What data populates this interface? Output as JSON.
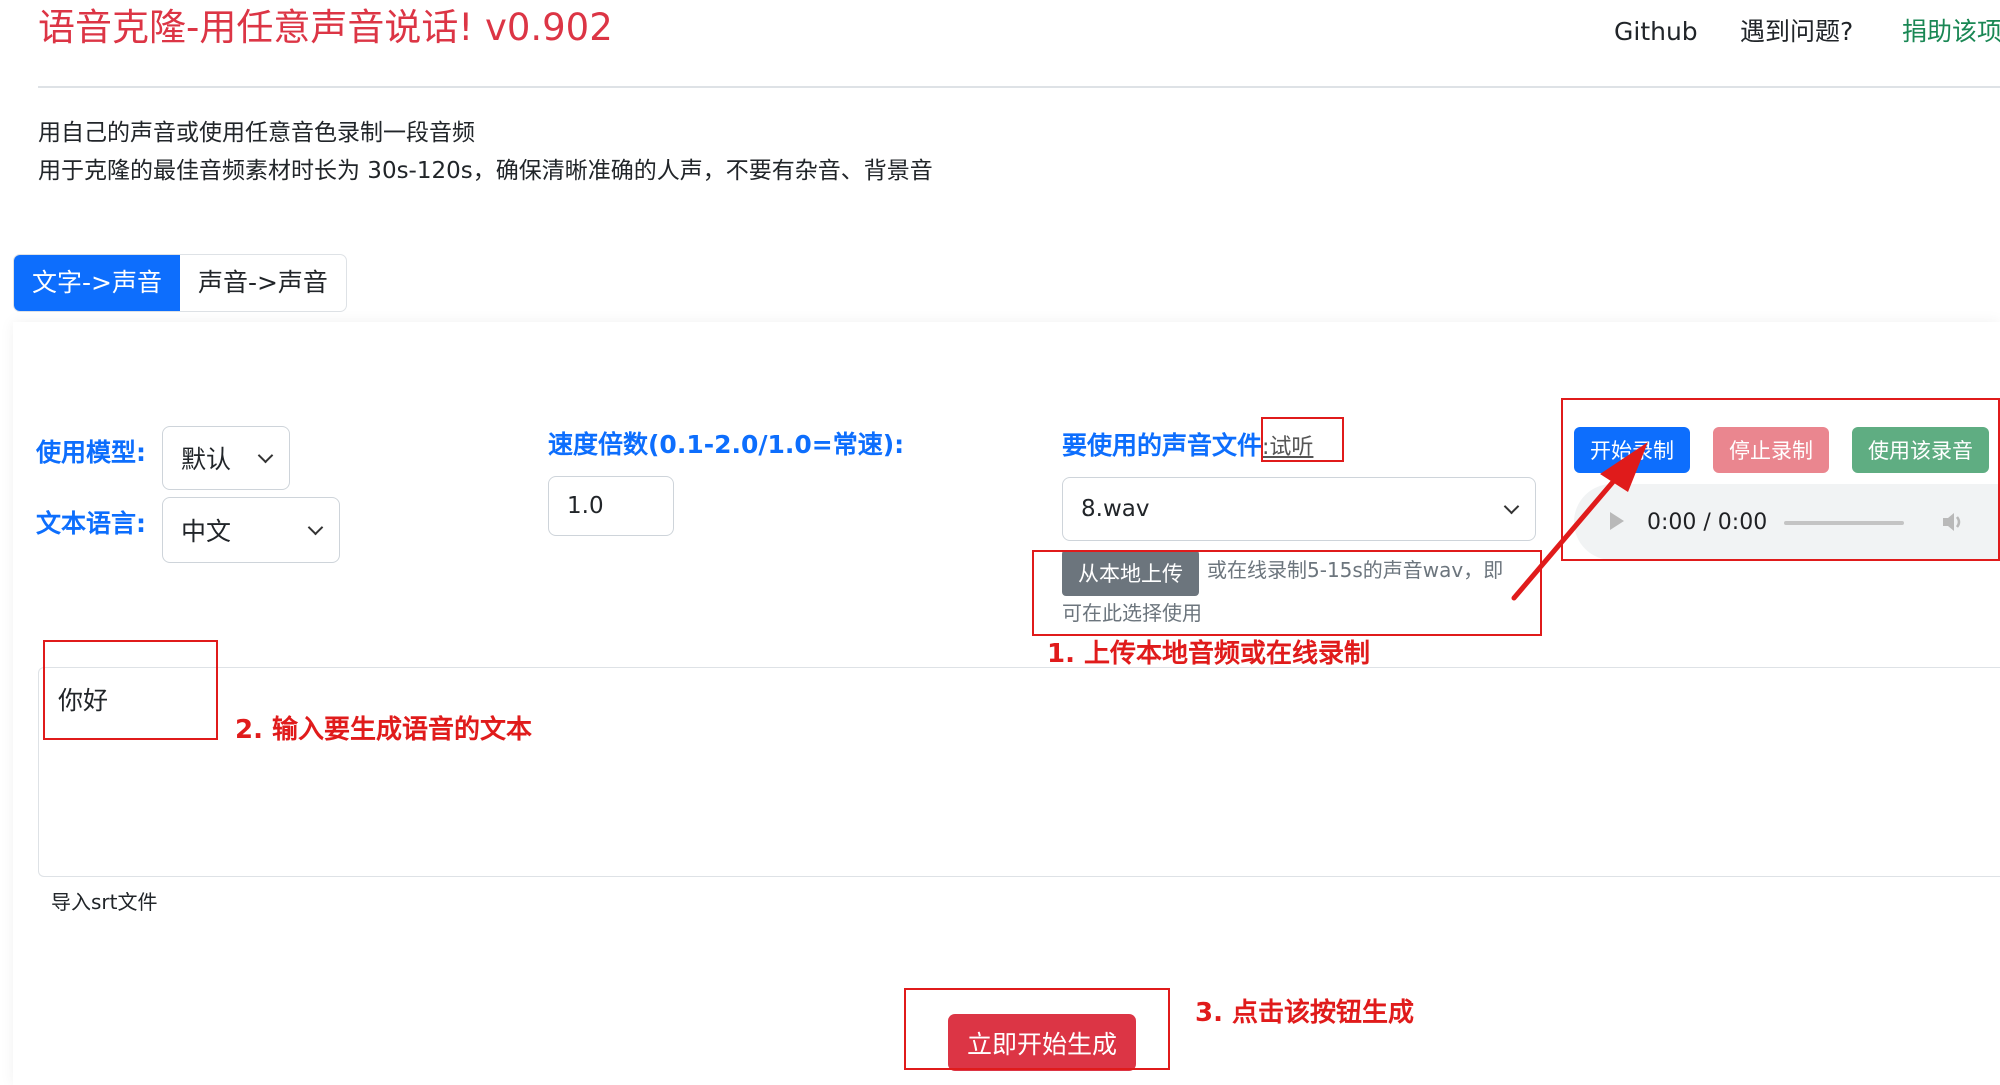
{
  "header": {
    "title": "语音克隆-用任意声音说话! v0.902",
    "nav": [
      "Github",
      "遇到问题?",
      "捐助该项"
    ]
  },
  "intro": {
    "line1": "用自己的声音或使用任意音色录制一段音频",
    "line2": "用于克隆的最佳音频素材时长为 30s-120s，确保清晰准确的人声，不要有杂音、背景音"
  },
  "tabs": [
    {
      "label": "文字->声音",
      "active": true
    },
    {
      "label": "声音->声音",
      "active": false
    }
  ],
  "form": {
    "model_label": "使用模型:",
    "model_value": "默认",
    "language_label": "文本语言:",
    "language_value": "中文",
    "speed_label": "速度倍数(0.1-2.0/1.0=常速):",
    "speed_value": "1.0",
    "voice_label": "要使用的声音文件",
    "preview_link": ":试听",
    "voice_value": "8.wav",
    "upload_button": "从本地上传",
    "upload_hint_line1": "或在线录制5-15s的声音wav，即",
    "upload_hint_line2": "可在此选择使用"
  },
  "recorder": {
    "start_label": "开始录制",
    "stop_label": "停止录制",
    "use_label": "使用该录音",
    "time": "0:00 / 0:00"
  },
  "text_input": {
    "value": "你好",
    "import_srt": "导入srt文件"
  },
  "generate_button": "立即开始生成",
  "annotations": {
    "step1": "1. 上传本地音频或在线录制",
    "step2": "2. 输入要生成语音的文本",
    "step3": "3. 点击该按钮生成"
  },
  "colors": {
    "primary": "#0d6efd",
    "danger": "#dc3545",
    "success": "#198754",
    "annotation": "#e01b1b"
  }
}
